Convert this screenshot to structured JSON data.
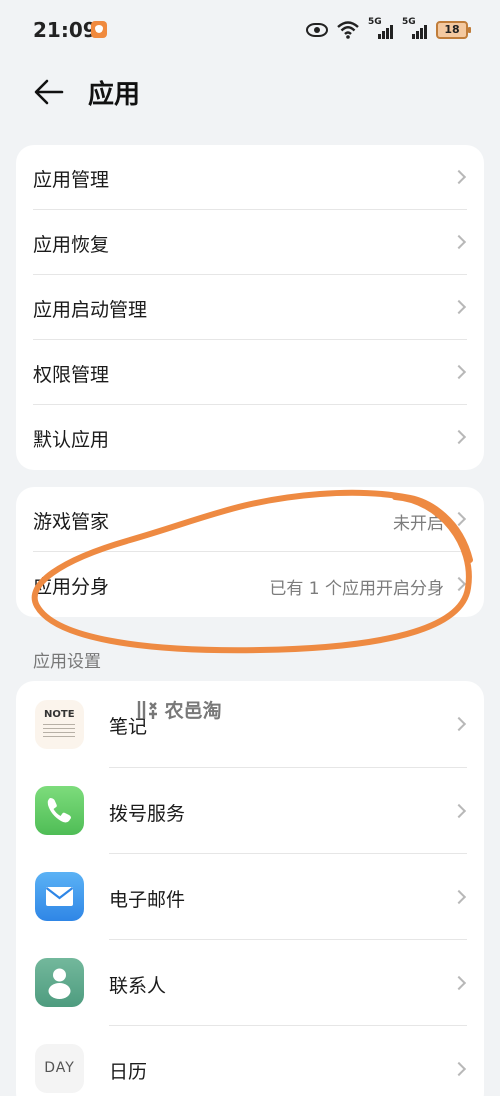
{
  "status_bar": {
    "time": "21:09",
    "signal1_label": "5G",
    "signal2_label": "5G",
    "battery": "18",
    "icons": [
      "shield-icon",
      "eye-icon",
      "wifi-icon",
      "signal-icon",
      "battery-icon"
    ]
  },
  "header": {
    "back_icon": "arrow-left-icon",
    "title": "应用"
  },
  "card1": {
    "items": [
      {
        "label": "应用管理"
      },
      {
        "label": "应用恢复"
      },
      {
        "label": "应用启动管理"
      },
      {
        "label": "权限管理"
      },
      {
        "label": "默认应用"
      }
    ]
  },
  "card2": {
    "items": [
      {
        "label": "游戏管家",
        "value": "未开启"
      },
      {
        "label": "应用分身",
        "value": "已有 1 个应用开启分身"
      }
    ]
  },
  "section": {
    "title": "应用设置"
  },
  "apps": {
    "items": [
      {
        "label": "笔记",
        "icon": "notes-icon",
        "icon_text": "NOTE"
      },
      {
        "label": "拨号服务",
        "icon": "phone-icon"
      },
      {
        "label": "电子邮件",
        "icon": "mail-icon"
      },
      {
        "label": "联系人",
        "icon": "contacts-icon"
      },
      {
        "label": "日历",
        "icon": "calendar-icon",
        "icon_text": "DAY"
      }
    ]
  },
  "watermark": {
    "text": "农邑淘",
    "color": "#6a6a6a"
  },
  "colors": {
    "background": "#f1f3f5",
    "card": "#ffffff",
    "annotation_stroke": "#ee8a42",
    "secondary_text": "#7c7c7c"
  }
}
